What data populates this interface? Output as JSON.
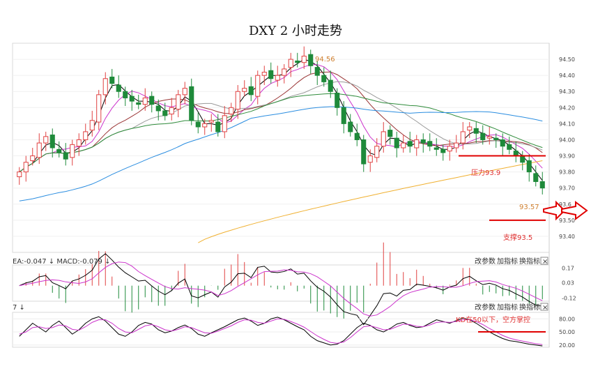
{
  "page": {
    "title": "DXY 2 小时走势"
  },
  "toolbar": {
    "macd_label": "EA:-0.047 ↓ MACD:-0.079 ↓",
    "kdj_label": "7 ↓",
    "items": [
      "改参数",
      "加指标",
      "换指标"
    ],
    "close": "×"
  },
  "annotations": {
    "high": "94.56",
    "pressure": "压力93.9",
    "target": "93.57",
    "support": "支撑93.5",
    "kd_note": "KD在50以下，空方掌控"
  },
  "colors": {
    "bull": "#e04040",
    "bear": "#1e8a3a",
    "ma_black": "#000000",
    "ma_purple": "#cc33cc",
    "ma_red": "#993333",
    "ma_gray": "#999999",
    "ma_green": "#2e8b3a",
    "ma_blue": "#2a8de0",
    "ma_orange": "#f0b030",
    "level_red": "#e00000",
    "arrow": "#e00000"
  },
  "chart_data": [
    {
      "type": "candlestick",
      "title": "DXY 2 小时走势",
      "ylim": [
        93.3,
        94.6
      ],
      "yticks": [
        94.5,
        94.4,
        94.3,
        94.2,
        94.1,
        94.0,
        93.9,
        93.8,
        93.7,
        93.6,
        93.5,
        93.4
      ],
      "ytick_labels": [
        "94.50",
        "94.40",
        "94.30",
        "94.20",
        "94.10",
        "94.00",
        "93.90",
        "93.80",
        "93.70",
        "93.6",
        "93.50",
        "93.40"
      ],
      "high": 94.56,
      "levels": [
        {
          "name": "压力93.9",
          "value": 93.9
        },
        {
          "name": "支撑93.5",
          "value": 93.5
        }
      ],
      "target": 93.57,
      "closes": [
        93.8,
        93.86,
        93.9,
        93.98,
        94.02,
        93.95,
        93.92,
        93.88,
        93.97,
        94.0,
        94.05,
        94.12,
        94.28,
        94.38,
        94.35,
        94.3,
        94.26,
        94.24,
        94.22,
        94.26,
        94.22,
        94.18,
        94.15,
        94.2,
        94.28,
        94.32,
        94.12,
        94.08,
        94.1,
        94.12,
        94.05,
        94.15,
        94.2,
        94.3,
        94.32,
        94.28,
        94.4,
        94.42,
        94.38,
        94.4,
        94.44,
        94.5,
        94.48,
        94.52,
        94.46,
        94.4,
        94.36,
        94.3,
        94.2,
        94.1,
        94.05,
        94.0,
        93.85,
        93.9,
        93.96,
        94.05,
        94.02,
        93.95,
        93.98,
        93.96,
        94.0,
        93.98,
        93.96,
        93.94,
        93.92,
        93.96,
        93.98,
        94.05,
        94.08,
        94.04,
        94.0,
        94.02,
        94.0,
        93.96,
        93.94,
        93.9,
        93.86,
        93.8,
        93.74,
        93.7
      ]
    },
    {
      "type": "macd",
      "yticks": [
        0.17,
        0.03,
        -0.12
      ],
      "ytick_labels": [
        "0.17",
        "0.03",
        "-0.12"
      ],
      "ylim": [
        -0.15,
        0.2
      ]
    },
    {
      "type": "kdj",
      "yticks": [
        80,
        50,
        20
      ],
      "ytick_labels": [
        "80.00",
        "50.00",
        "20.00"
      ],
      "ylim": [
        15,
        95
      ],
      "k": [
        40,
        55,
        70,
        60,
        50,
        65,
        75,
        60,
        45,
        55,
        70,
        80,
        85,
        75,
        60,
        45,
        40,
        50,
        65,
        72,
        68,
        55,
        48,
        52,
        60,
        66,
        58,
        45,
        40,
        48,
        55,
        62,
        70,
        78,
        82,
        75,
        65,
        70,
        80,
        84,
        78,
        70,
        62,
        55,
        40,
        30,
        25,
        20,
        22,
        30,
        45,
        60,
        70,
        65,
        55,
        50,
        58,
        68,
        72,
        65,
        60,
        62,
        70,
        78,
        74,
        70,
        76,
        82,
        78,
        70,
        60,
        50,
        42,
        35,
        30,
        28,
        25,
        22,
        20,
        18
      ],
      "d": [
        45,
        50,
        60,
        62,
        58,
        60,
        66,
        64,
        56,
        54,
        62,
        72,
        78,
        78,
        70,
        58,
        50,
        48,
        56,
        64,
        67,
        62,
        55,
        52,
        56,
        62,
        60,
        54,
        48,
        47,
        52,
        58,
        64,
        72,
        78,
        77,
        72,
        70,
        75,
        80,
        79,
        74,
        68,
        61,
        51,
        41,
        33,
        26,
        24,
        27,
        37,
        50,
        62,
        64,
        60,
        55,
        56,
        62,
        68,
        67,
        63,
        62,
        66,
        72,
        73,
        72,
        74,
        78,
        78,
        74,
        67,
        58,
        50,
        42,
        36,
        32,
        29,
        26,
        23,
        21
      ]
    }
  ]
}
